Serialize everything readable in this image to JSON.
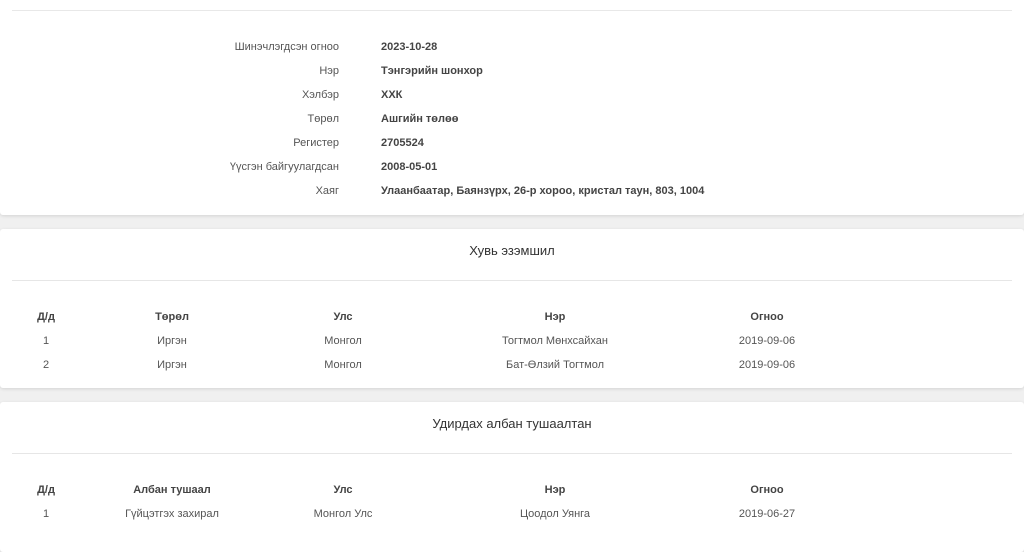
{
  "info": {
    "rows": [
      {
        "label": "Шинэчлэгдсэн огноо",
        "value": "2023-10-28"
      },
      {
        "label": "Нэр",
        "value": "Тэнгэрийн шонхор"
      },
      {
        "label": "Хэлбэр",
        "value": "ХХК"
      },
      {
        "label": "Төрөл",
        "value": "Ашгийн төлөө"
      },
      {
        "label": "Регистер",
        "value": "2705524"
      },
      {
        "label": "Үүсгэн байгуулагдсан",
        "value": "2008-05-01"
      },
      {
        "label": "Хаяг",
        "value": "Улаанбаатар, Баянзүрх, 26-р хороо, кристал таун, 803, 1004"
      }
    ]
  },
  "owners": {
    "title": "Хувь эзэмшил",
    "headers": [
      "Д/д",
      "Төрөл",
      "Улс",
      "Нэр",
      "Огноо"
    ],
    "rows": [
      [
        "1",
        "Иргэн",
        "Монгол",
        "Тогтмол Мөнхсайхан",
        "2019-09-06"
      ],
      [
        "2",
        "Иргэн",
        "Монгол",
        "Бат-Өлзий Тогтмол",
        "2019-09-06"
      ]
    ]
  },
  "officials": {
    "title": "Удирдах албан тушаалтан",
    "headers": [
      "Д/д",
      "Албан тушаал",
      "Улс",
      "Нэр",
      "Огноо"
    ],
    "rows": [
      [
        "1",
        "Гүйцэтгэх захирал",
        "Монгол Улс",
        "Цоодол Уянга",
        "2019-06-27"
      ]
    ]
  }
}
